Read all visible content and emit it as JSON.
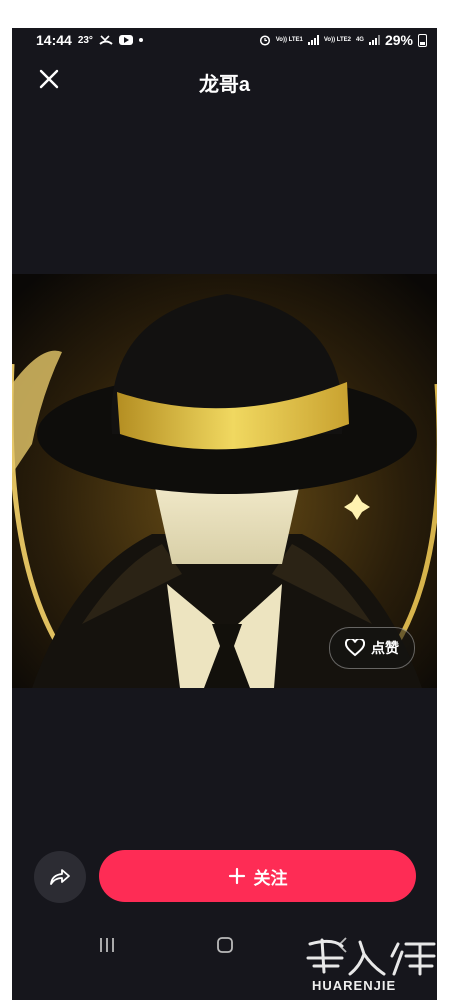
{
  "status_bar": {
    "time": "14:44",
    "temperature": "23°",
    "sim1": "Vo)) LTE1",
    "sim2": "Vo)) LTE2",
    "network": "4G",
    "battery": "29%"
  },
  "header": {
    "title": "龙哥a",
    "close_icon": "close-icon"
  },
  "photo": {
    "description_icon": "avatar-image",
    "hat_band_color": "#d8b93a"
  },
  "like": {
    "label": "点赞",
    "icon": "heart-outline-icon"
  },
  "actions": {
    "share_icon": "share-arrow-icon",
    "follow_label": "关注",
    "follow_icon": "plus-icon",
    "accent_color": "#fe2c55"
  },
  "nav_bar": {
    "recents_icon": "recents-icon",
    "home_icon": "home-icon",
    "back_icon": "back-icon"
  },
  "watermark": {
    "text": "HUARENJIE"
  }
}
